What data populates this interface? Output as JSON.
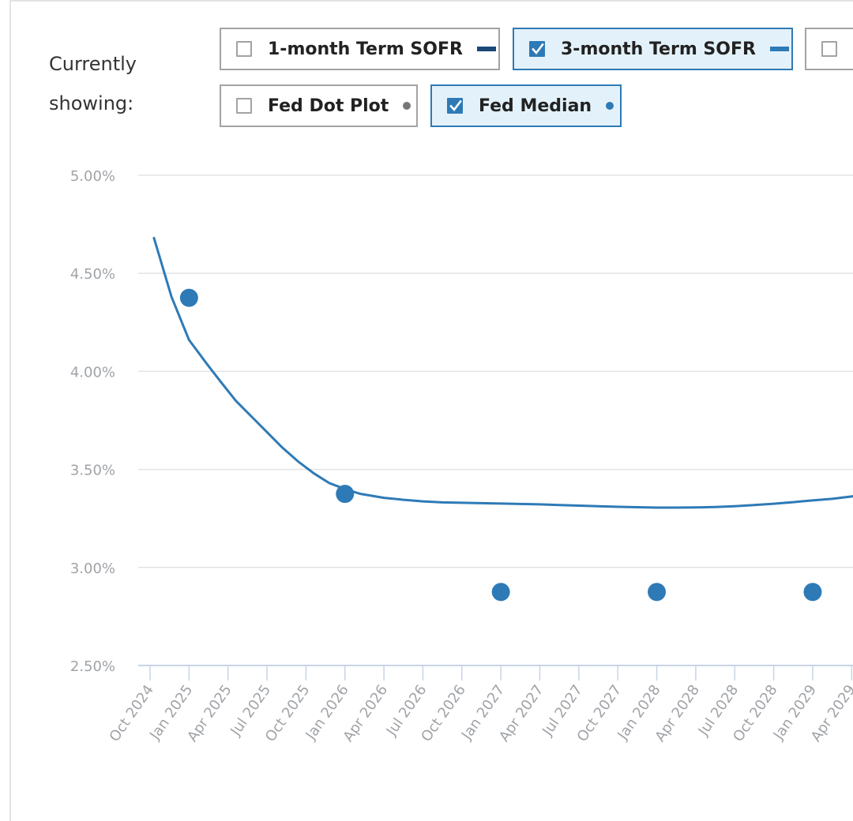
{
  "controls": {
    "showing_label": "Currently showing:",
    "toggles": [
      {
        "label": "1-month Term SOFR",
        "checked": false,
        "swatch": "line",
        "color": "#1a4878"
      },
      {
        "label": "3-month Term SOFR",
        "checked": true,
        "swatch": "line",
        "color": "#2e7ab6"
      },
      {
        "label": "",
        "checked": false,
        "swatch": "none",
        "color": ""
      },
      {
        "label": "Fed Dot Plot",
        "checked": false,
        "swatch": "dot",
        "color": "#777777"
      },
      {
        "label": "Fed Median",
        "checked": true,
        "swatch": "dot",
        "color": "#2e7ab6"
      }
    ]
  },
  "colors": {
    "accent": "#2e7ab6",
    "grid": "#e3e3e3",
    "axis": "#c9d4e6",
    "tick_text": "#a0a3a7"
  },
  "chart_data": {
    "type": "line",
    "title": "",
    "xlabel": "",
    "ylabel": "",
    "ylim": [
      2.5,
      5.0
    ],
    "y_ticks": [
      "2.50%",
      "3.00%",
      "3.50%",
      "4.00%",
      "4.50%",
      "5.00%"
    ],
    "y_tick_values": [
      2.5,
      3.0,
      3.5,
      4.0,
      4.5,
      5.0
    ],
    "x_ticks": [
      "Oct 2024",
      "Jan 2025",
      "Apr 2025",
      "Jul 2025",
      "Oct 2025",
      "Jan 2026",
      "Apr 2026",
      "Jul 2026",
      "Oct 2026",
      "Jan 2027",
      "Apr 2027",
      "Jul 2027",
      "Oct 2027",
      "Jan 2028",
      "Apr 2028",
      "Jul 2028",
      "Oct 2028",
      "Jan 2029",
      "Apr 2029"
    ],
    "x_unit": "quarters since Oct 2024",
    "grid": true,
    "series": [
      {
        "name": "3-month Term SOFR",
        "kind": "line",
        "color": "#2e7ab6",
        "x": [
          0.1,
          0.55,
          1.0,
          1.45,
          1.8,
          2.2,
          2.7,
          3.0,
          3.4,
          3.8,
          4.2,
          4.6,
          5.0,
          5.4,
          6.0,
          6.5,
          7.0,
          7.5,
          8.0,
          8.5,
          9.0,
          9.5,
          10.0,
          10.5,
          11.0,
          11.5,
          12.0,
          12.5,
          13.0,
          13.5,
          14.0,
          14.5,
          15.0,
          15.5,
          16.0,
          16.5,
          17.0,
          17.5,
          18.0,
          18.2
        ],
        "values": [
          4.68,
          4.38,
          4.16,
          4.04,
          3.95,
          3.85,
          3.75,
          3.69,
          3.61,
          3.54,
          3.48,
          3.43,
          3.4,
          3.375,
          3.355,
          3.345,
          3.337,
          3.332,
          3.33,
          3.328,
          3.326,
          3.324,
          3.322,
          3.318,
          3.315,
          3.312,
          3.309,
          3.307,
          3.305,
          3.305,
          3.306,
          3.308,
          3.312,
          3.318,
          3.325,
          3.333,
          3.342,
          3.35,
          3.362,
          3.37
        ]
      },
      {
        "name": "Fed Median",
        "kind": "scatter",
        "color": "#2e7ab6",
        "x": [
          1,
          5,
          9,
          13,
          17
        ],
        "x_labels": [
          "Jan 2025",
          "Jan 2026",
          "Jan 2027",
          "Jan 2028",
          "Jan 2029"
        ],
        "values": [
          4.375,
          3.375,
          2.875,
          2.875,
          2.875
        ]
      }
    ]
  }
}
